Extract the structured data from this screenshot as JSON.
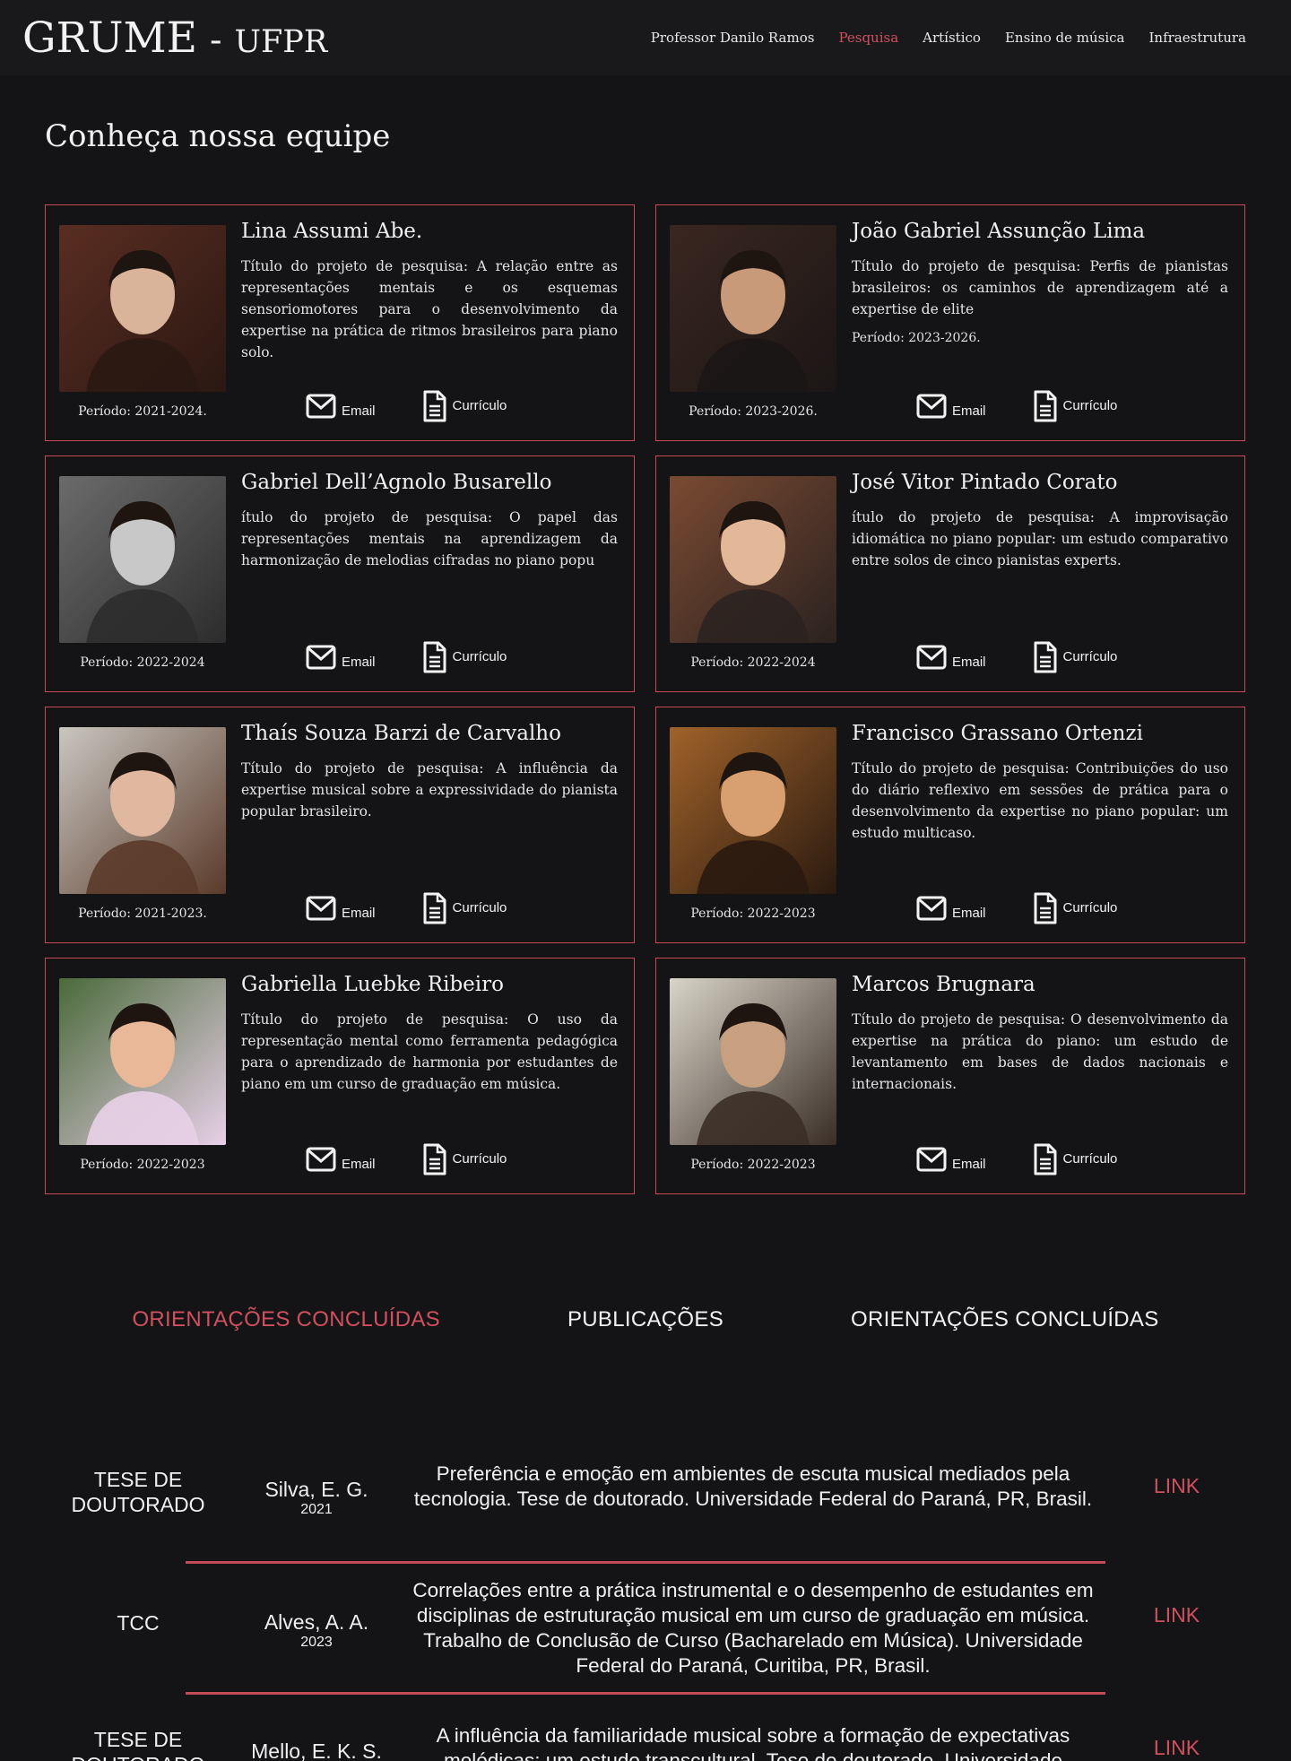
{
  "header": {
    "brand": "GRUME",
    "brand_sep": "-",
    "brand_sub": "UFPR",
    "nav": [
      {
        "label": "Professor Danilo Ramos",
        "active": false
      },
      {
        "label": "Pesquisa",
        "active": true
      },
      {
        "label": "Artístico",
        "active": false
      },
      {
        "label": "Ensino de música",
        "active": false
      },
      {
        "label": "Infraestrutura",
        "active": false
      }
    ]
  },
  "team": {
    "title": "Conheça nossa equipe",
    "email_label": "Email",
    "cv_label": "Currículo",
    "members": [
      {
        "name": "Lina Assumi Abe.",
        "desc": "Título do projeto de pesquisa: A relação entre as representações mentais e os esquemas sensoriomotores para o desenvolvimento da expertise na prática de ritmos brasileiros para piano solo.",
        "period": "Período: 2021-2024.",
        "desc_period": ""
      },
      {
        "name": "João Gabriel Assunção Lima",
        "desc": "Título do projeto de pesquisa: Perfis de pianistas brasileiros: os caminhos de aprendizagem até a expertise de elite",
        "period": "Período: 2023-2026.",
        "desc_period": "Período: 2023-2026."
      },
      {
        "name": "Gabriel Dell’Agnolo Busarello",
        "desc": "ítulo do projeto de pesquisa: O papel das representações mentais na aprendizagem da harmonização de melodias cifradas no piano popu",
        "period": "Período: 2022-2024",
        "desc_period": ""
      },
      {
        "name": "José Vitor Pintado Corato",
        "desc": "ítulo do projeto de pesquisa: A improvisação idiomática no piano popular: um estudo comparativo entre solos de cinco pianistas experts.",
        "period": "Período: 2022-2024",
        "desc_period": ""
      },
      {
        "name": "Thaís Souza Barzi de Carvalho",
        "desc": "Título do projeto de pesquisa: A influência da expertise musical sobre a expressividade do pianista popular brasileiro.",
        "period": "Período: 2021-2023.",
        "desc_period": ""
      },
      {
        "name": "Francisco Grassano Ortenzi",
        "desc": "Título do projeto de pesquisa: Contribuições do uso do diário reflexivo em sessões de prática para o desenvolvimento da expertise no piano popular: um estudo multicaso.",
        "period": "Período: 2022-2023",
        "desc_period": ""
      },
      {
        "name": "Gabriella Luebke Ribeiro",
        "desc": "Título do projeto de pesquisa: O uso da representação mental como ferramenta pedagógica para o aprendizado de harmonia por estudantes de piano em um curso de graduação em música.",
        "period": "Período: 2022-2023",
        "desc_period": ""
      },
      {
        "name": "Marcos Brugnara",
        "desc": "Título do projeto de pesquisa: O desenvolvimento da expertise na prática do piano: um estudo de levantamento em bases de dados nacionais e internacionais.",
        "period": "Período: 2022-2023",
        "desc_period": ""
      }
    ]
  },
  "tabs": [
    {
      "label": "ORIENTAÇÕES CONCLUÍDAS",
      "active": true
    },
    {
      "label": "PUBLICAÇÕES",
      "active": false
    },
    {
      "label": "ORIENTAÇÕES CONCLUÍDAS",
      "active": false
    }
  ],
  "works": [
    {
      "type": "TESE DE DOUTORADO",
      "author": "Silva, E. G.",
      "year": "2021",
      "ref": "Preferência e emoção em ambientes de escuta musical mediados pela tecnologia. Tese de doutorado. Universidade Federal do Paraná, PR, Brasil.",
      "link": "LINK"
    },
    {
      "type": "TCC",
      "author": "Alves, A. A.",
      "year": "2023",
      "ref": "Correlações entre a prática instrumental e o desempenho de estudantes em disciplinas de estruturação musical em um curso de graduação em música. Trabalho de Conclusão de Curso (Bacharelado em Música). Universidade Federal do Paraná, Curitiba, PR, Brasil.",
      "link": "LINK"
    },
    {
      "type": "TESE DE DOUTORADO",
      "author": "Mello, E. K. S.",
      "year": "",
      "ref": "A influência da familiaridade musical sobre a formação de expectativas melódicas: um estudo transcultural. Tese de doutorado. Universidade",
      "link": "LINK"
    }
  ],
  "colors": {
    "accent": "#d0505f",
    "border": "#c44a58",
    "background": "#141417"
  }
}
